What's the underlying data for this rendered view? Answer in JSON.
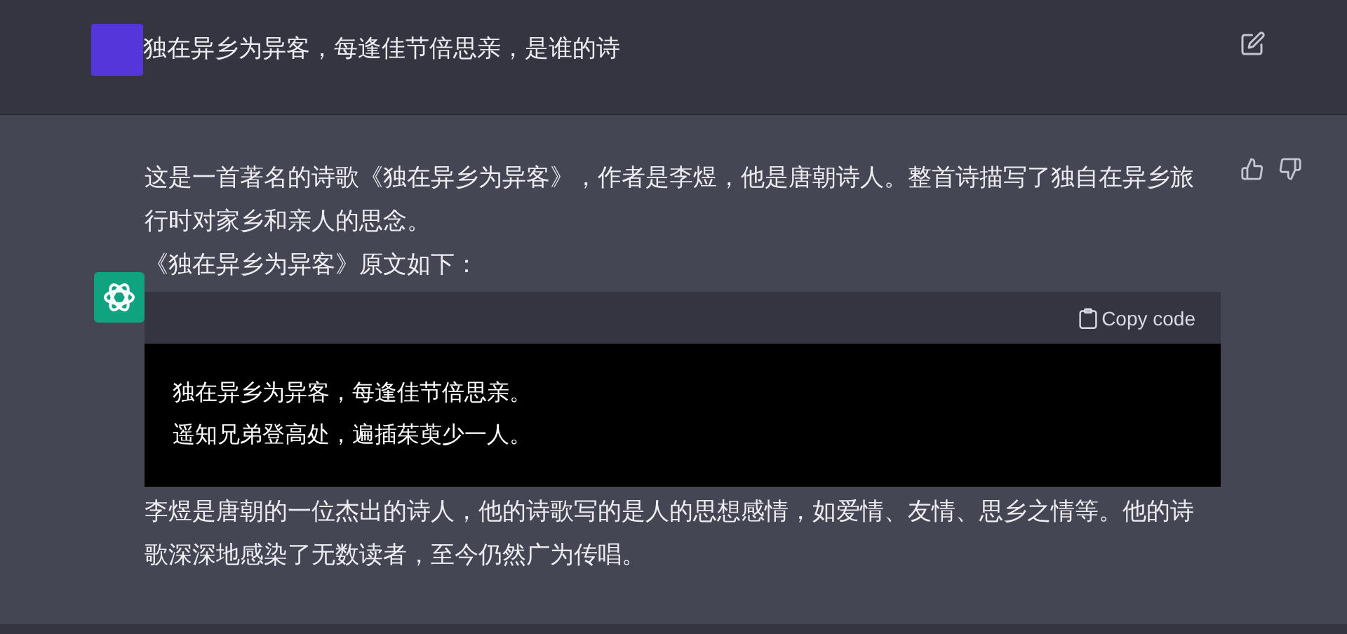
{
  "question": {
    "text": "独在异乡为异客，每逢佳节倍思亲，是谁的诗"
  },
  "answer": {
    "paragraphs": [
      "这是一首著名的诗歌《独在异乡为异客》，作者是李煜，他是唐朝诗人。整首诗描写了独自在异乡旅行时对家乡和亲人的思念。",
      "《独在异乡为异客》原文如下："
    ],
    "code": {
      "copy_label": "Copy code",
      "lines": [
        "独在异乡为异客，每逢佳节倍思亲。",
        "遥知兄弟登高处，遍插茱萸少一人。"
      ]
    },
    "closing": "李煜是唐朝的一位杰出的诗人，他的诗歌写的是人的思想感情，如爱情、友情、思乡之情等。他的诗歌深深地感染了无数读者，至今仍然广为传唱。"
  }
}
